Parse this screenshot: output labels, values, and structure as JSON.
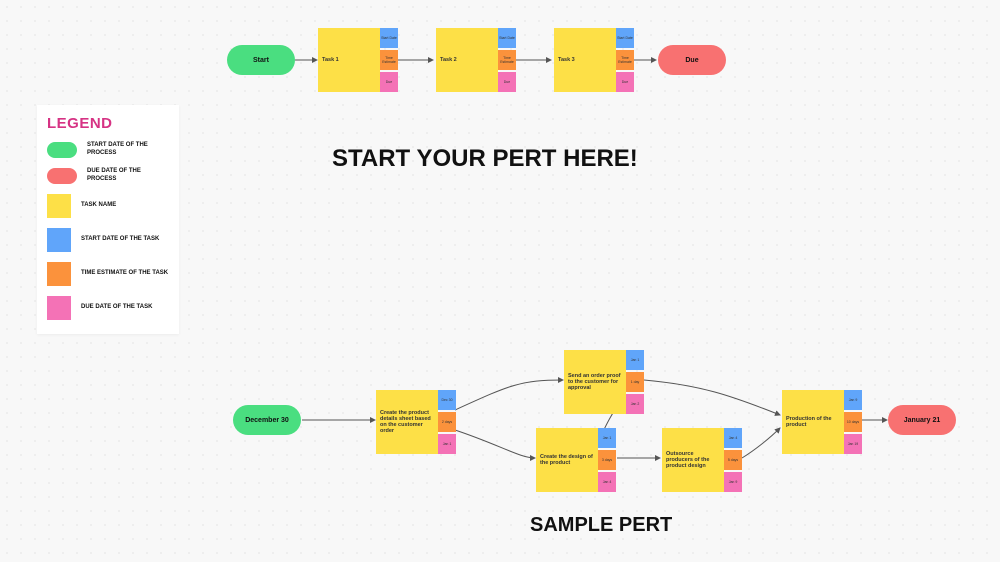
{
  "legend": {
    "title": "LEGEND",
    "items": [
      {
        "label": "START DATE OF THE PROCESS",
        "color": "#4ade80",
        "shape": "pill"
      },
      {
        "label": "DUE DATE OF THE PROCESS",
        "color": "#f87171",
        "shape": "pill"
      },
      {
        "label": "TASK NAME",
        "color": "#fde047",
        "shape": "sq"
      },
      {
        "label": "START DATE OF THE TASK",
        "color": "#60a5fa",
        "shape": "sq"
      },
      {
        "label": "TIME ESTIMATE OF THE TASK",
        "color": "#fb923c",
        "shape": "sq"
      },
      {
        "label": "DUE DATE OF THE TASK",
        "color": "#f472b6",
        "shape": "sq"
      }
    ]
  },
  "headings": {
    "top": "START YOUR PERT HERE!",
    "bottom": "SAMPLE PERT"
  },
  "template_row": {
    "start": {
      "label": "Start"
    },
    "tasks": [
      {
        "name": "Task 1",
        "start": "Start Date",
        "est": "Time Estimate",
        "due": "Due"
      },
      {
        "name": "Task 2",
        "start": "Start Date",
        "est": "Time Estimate",
        "due": "Due"
      },
      {
        "name": "Task 3",
        "start": "Start Date",
        "est": "Time Estimate",
        "due": "Due"
      }
    ],
    "due": {
      "label": "Due"
    }
  },
  "sample": {
    "start": {
      "label": "December 30"
    },
    "t1": {
      "name": "Create the product details sheet based on the customer order",
      "start": "Dec 30",
      "est": "2 days",
      "due": "Jan 1"
    },
    "t2": {
      "name": "Send an order proof to the customer for approval",
      "start": "Jan 1",
      "est": "1 day",
      "due": "Jan 2"
    },
    "t3": {
      "name": "Create the design of the product",
      "start": "Jan 1",
      "est": "3 days",
      "due": "Jan 4"
    },
    "t4": {
      "name": "Outsource producers of the product design",
      "start": "Jan 4",
      "est": "5 days",
      "due": "Jan 9"
    },
    "t5": {
      "name": "Production of the product",
      "start": "Jan 9",
      "est": "10 days",
      "due": "Jan 19"
    },
    "due": {
      "label": "January 21"
    }
  },
  "colors": {
    "green": "#4ade80",
    "red": "#f87171",
    "yellow": "#fde047",
    "blue": "#60a5fa",
    "orange": "#fb923c",
    "pink": "#f472b6"
  }
}
